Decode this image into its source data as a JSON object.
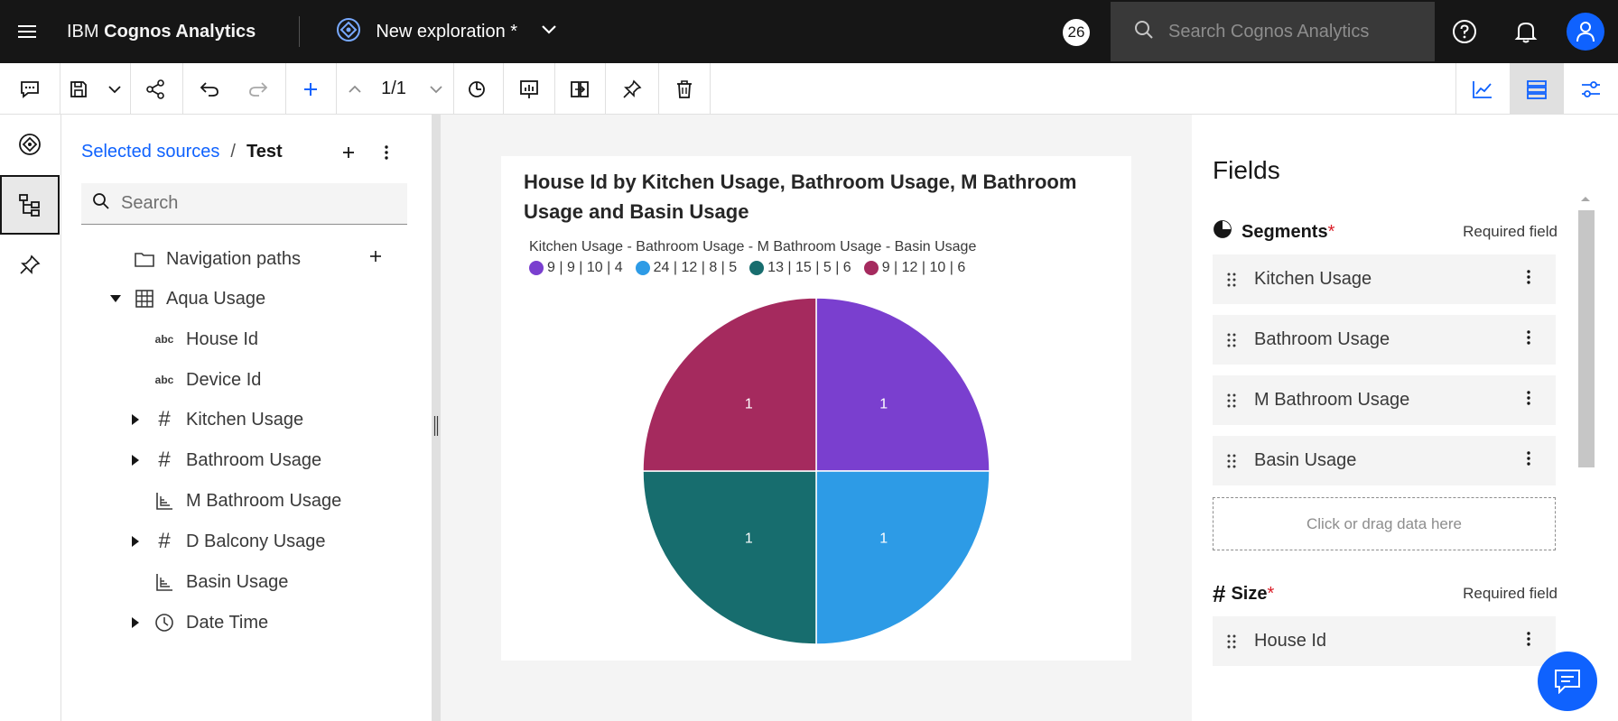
{
  "header": {
    "brand_prefix": "IBM",
    "brand_name": "Cognos Analytics",
    "exploration_title": "New exploration *",
    "notification_count": "26",
    "search_placeholder": "Search Cognos Analytics"
  },
  "toolbar": {
    "page_indicator": "1/1"
  },
  "sources": {
    "breadcrumb_link": "Selected sources",
    "breadcrumb_sep": "/",
    "breadcrumb_current": "Test",
    "search_placeholder": "Search",
    "tree": [
      {
        "label": "Navigation paths",
        "icon": "folder-icon"
      },
      {
        "label": "Aqua Usage",
        "icon": "table-icon"
      },
      {
        "label": "House Id",
        "icon": "abc-icon"
      },
      {
        "label": "Device Id",
        "icon": "abc-icon"
      },
      {
        "label": "Kitchen Usage",
        "icon": "hash-icon"
      },
      {
        "label": "Bathroom Usage",
        "icon": "hash-icon"
      },
      {
        "label": "M Bathroom Usage",
        "icon": "dimension-icon"
      },
      {
        "label": "D Balcony Usage",
        "icon": "hash-icon"
      },
      {
        "label": "Basin Usage",
        "icon": "dimension-icon"
      },
      {
        "label": "Date Time",
        "icon": "clock-icon"
      }
    ]
  },
  "chart_data": {
    "type": "pie",
    "title": "House Id by Kitchen Usage, Bathroom Usage, M Bathroom Usage and Basin Usage",
    "legend_title": "Kitchen Usage - Bathroom Usage - M Bathroom Usage - Basin Usage",
    "legend_position": "top-left",
    "slices": [
      {
        "label": "9 | 9 | 10 | 4",
        "value": 1,
        "color": "#7a3fcf"
      },
      {
        "label": "24 | 12 | 8 | 5",
        "value": 1,
        "color": "#2d9be6"
      },
      {
        "label": "13 | 15 | 5 | 6",
        "value": 1,
        "color": "#176d6e"
      },
      {
        "label": "9 | 12 | 10 | 6",
        "value": 1,
        "color": "#a52a5e"
      }
    ]
  },
  "fields": {
    "title": "Fields",
    "segments_label": "Segments",
    "required_mark": "*",
    "required_text": "Required field",
    "segments": [
      "Kitchen Usage",
      "Bathroom Usage",
      "M Bathroom Usage",
      "Basin Usage"
    ],
    "dropzone_text": "Click or drag data here",
    "size_label": "Size",
    "size_items": [
      "House Id"
    ]
  }
}
